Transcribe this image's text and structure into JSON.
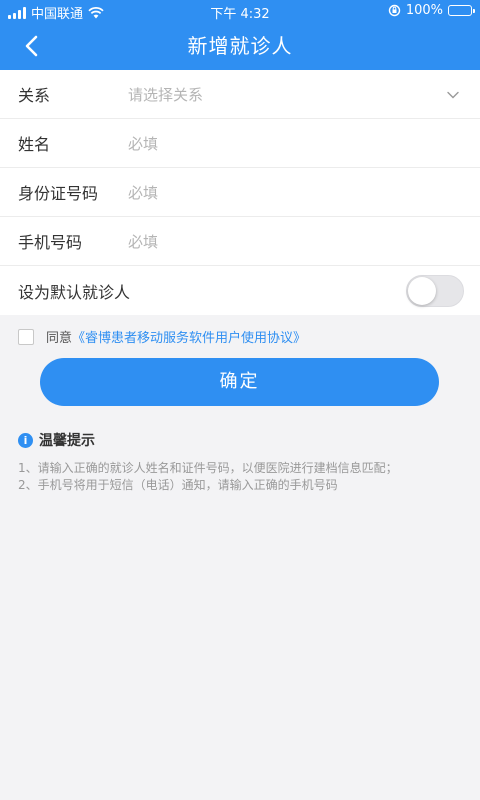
{
  "status_bar": {
    "carrier": "中国联通",
    "time": "下午 4:32",
    "battery": "100%"
  },
  "header": {
    "title": "新增就诊人"
  },
  "form": {
    "relation": {
      "label": "关系",
      "placeholder": "请选择关系"
    },
    "name": {
      "label": "姓名",
      "placeholder": "必填"
    },
    "id_number": {
      "label": "身份证号码",
      "placeholder": "必填"
    },
    "phone": {
      "label": "手机号码",
      "placeholder": "必填"
    },
    "default_patient": {
      "label": "设为默认就诊人",
      "enabled": false
    }
  },
  "agreement": {
    "checked": false,
    "prefix": "同意",
    "link": "《睿博患者移动服务软件用户使用协议》"
  },
  "confirm_button": "确定",
  "tips": {
    "title": "温馨提示",
    "icon": "info-icon",
    "lines": [
      "1、请输入正确的就诊人姓名和证件号码，以便医院进行建档信息匹配；",
      "2、手机号将用于短信（电话）通知，请输入正确的手机号码"
    ]
  },
  "colors": {
    "primary": "#2f8ff2",
    "background": "#f3f3f5",
    "placeholder": "#b5b5b5"
  }
}
